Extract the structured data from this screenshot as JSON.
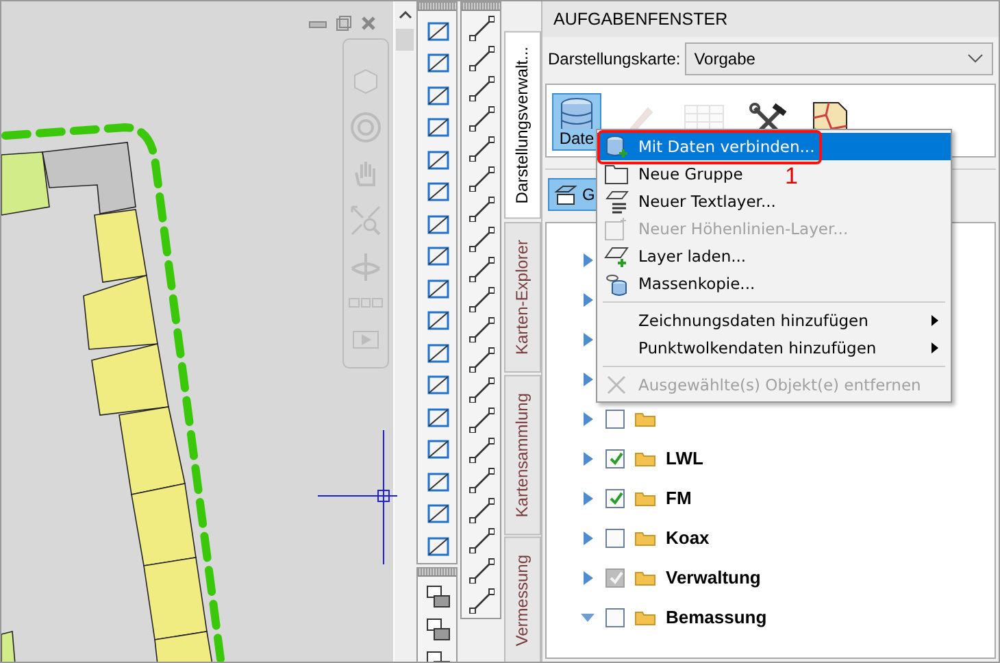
{
  "vertical_tabs": [
    {
      "label": "Darstellungsverwalt...",
      "selected": true
    },
    {
      "label": "Karten-Explorer",
      "selected": false
    },
    {
      "label": "Kartensammlung",
      "selected": false
    },
    {
      "label": "Vermessung",
      "selected": false
    }
  ],
  "task_panel": {
    "title": "AUFGABENFENSTER",
    "map_label": "Darstellungskarte:",
    "map_value": "Vorgabe",
    "tools": [
      {
        "kind": "database",
        "label": "Date",
        "selected": true,
        "disabled": false
      },
      {
        "kind": "brush",
        "selected": false,
        "disabled": true
      },
      {
        "kind": "table",
        "selected": false,
        "disabled": true
      },
      {
        "kind": "tools",
        "selected": false,
        "disabled": false
      },
      {
        "kind": "map",
        "selected": false,
        "disabled": false
      }
    ],
    "group_button": {
      "label": "G"
    },
    "tree": [
      {
        "expanded": false
      },
      {
        "expanded": false
      },
      {
        "expanded": false
      },
      {
        "expanded": false
      },
      {
        "expanded": false,
        "checked": false,
        "disabled": false
      },
      {
        "label": "LWL",
        "expanded": false,
        "checked": true,
        "disabled": false
      },
      {
        "label": "FM",
        "expanded": false,
        "checked": true,
        "disabled": false
      },
      {
        "label": "Koax",
        "expanded": false,
        "checked": false,
        "disabled": false
      },
      {
        "label": "Verwaltung",
        "expanded": false,
        "checked": true,
        "disabled": true
      },
      {
        "label": "Bemassung",
        "expanded": true,
        "checked": false,
        "disabled": false
      }
    ],
    "context_menu": [
      {
        "kind": "item",
        "label": "Mit Daten verbinden...",
        "highlighted": true,
        "disabled": false,
        "submenu": false
      },
      {
        "kind": "item",
        "label": "Neue Gruppe",
        "highlighted": false,
        "disabled": false,
        "submenu": false
      },
      {
        "kind": "item",
        "label": "Neuer Textlayer...",
        "highlighted": false,
        "disabled": false,
        "submenu": false
      },
      {
        "kind": "item",
        "label": "Neuer Höhenlinien-Layer...",
        "highlighted": false,
        "disabled": true,
        "submenu": false
      },
      {
        "kind": "item",
        "label": "Layer laden...",
        "highlighted": false,
        "disabled": false,
        "submenu": false
      },
      {
        "kind": "item",
        "label": "Massenkopie...",
        "highlighted": false,
        "disabled": false,
        "submenu": false
      },
      {
        "kind": "separator"
      },
      {
        "kind": "item",
        "label": "Zeichnungsdaten hinzufügen",
        "highlighted": false,
        "disabled": false,
        "submenu": true
      },
      {
        "kind": "item",
        "label": "Punktwolkendaten hinzufügen",
        "highlighted": false,
        "disabled": false,
        "submenu": true
      },
      {
        "kind": "separator"
      },
      {
        "kind": "item",
        "label": "Ausgewählte(s) Objekt(e) entfernen",
        "highlighted": false,
        "disabled": true,
        "submenu": false
      }
    ],
    "callout": {
      "number": "1"
    }
  }
}
